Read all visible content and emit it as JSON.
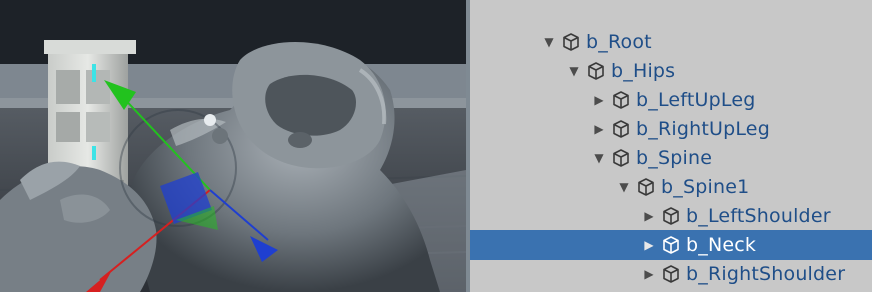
{
  "hierarchy": {
    "items": [
      {
        "label": "b_Root",
        "expanded": true,
        "depth": 0,
        "selected": false,
        "icon": "gameobject-icon"
      },
      {
        "label": "b_Hips",
        "expanded": true,
        "depth": 1,
        "selected": false,
        "icon": "gameobject-icon"
      },
      {
        "label": "b_LeftUpLeg",
        "expanded": false,
        "depth": 2,
        "selected": false,
        "icon": "gameobject-icon"
      },
      {
        "label": "b_RightUpLeg",
        "expanded": false,
        "depth": 2,
        "selected": false,
        "icon": "gameobject-icon"
      },
      {
        "label": "b_Spine",
        "expanded": true,
        "depth": 2,
        "selected": false,
        "icon": "gameobject-icon"
      },
      {
        "label": "b_Spine1",
        "expanded": true,
        "depth": 3,
        "selected": false,
        "icon": "gameobject-icon"
      },
      {
        "label": "b_LeftShoulder",
        "expanded": false,
        "depth": 4,
        "selected": false,
        "icon": "gameobject-icon"
      },
      {
        "label": "b_Neck",
        "expanded": false,
        "depth": 4,
        "selected": true,
        "icon": "gameobject-icon"
      },
      {
        "label": "b_RightShoulder",
        "expanded": false,
        "depth": 4,
        "selected": false,
        "icon": "gameobject-icon"
      }
    ]
  },
  "scene": {
    "gizmo_colors": {
      "y_axis": "#22c21e",
      "x_axis": "#d62020",
      "z_axis": "#1f3fd0"
    },
    "selection_color": "#3a72b0"
  },
  "icons": {
    "expanded": "▼",
    "collapsed": "▶"
  }
}
